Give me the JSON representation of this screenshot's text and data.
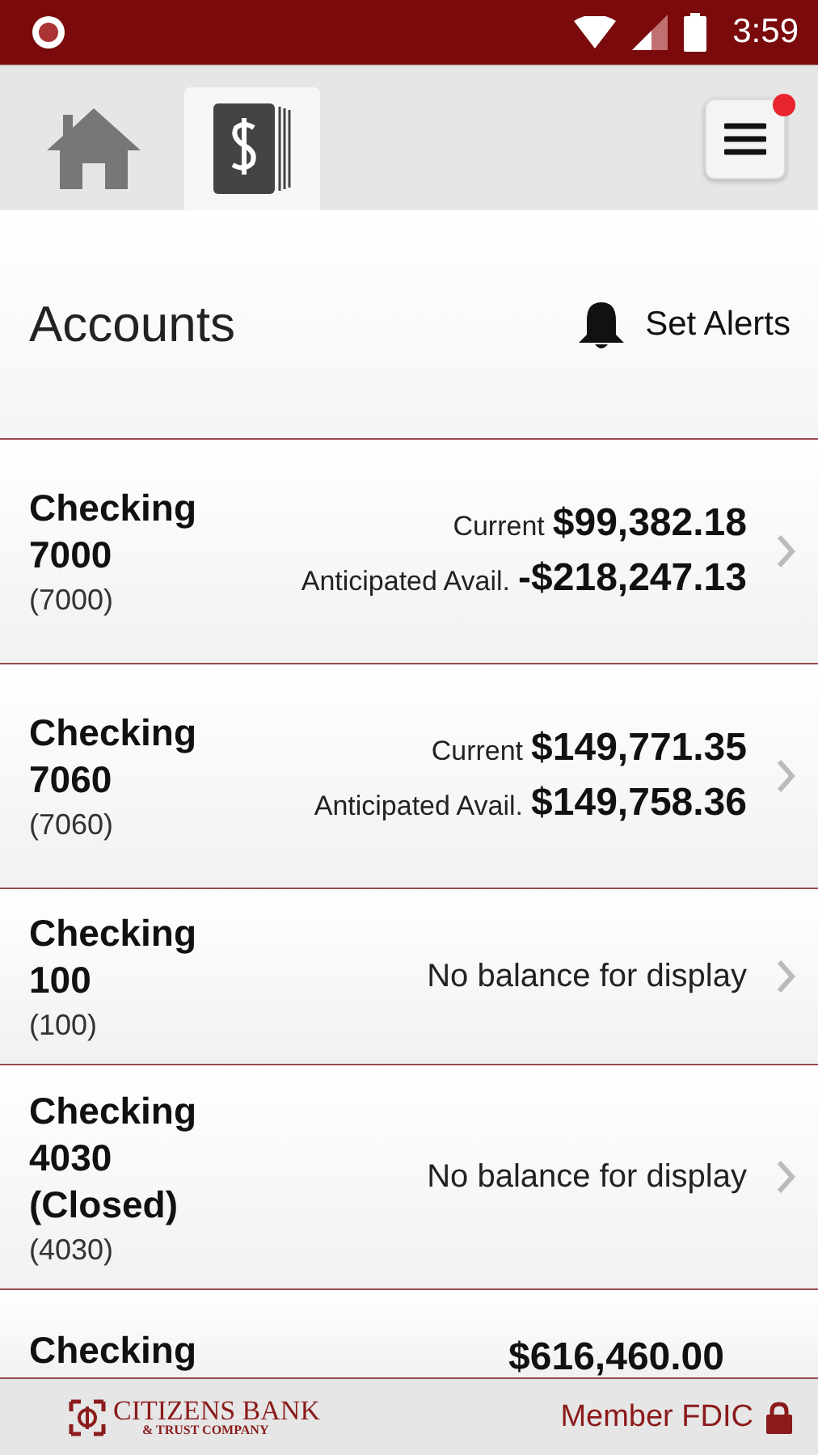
{
  "status_bar": {
    "time": "3:59"
  },
  "tabs": [
    {
      "kind": "home",
      "selected": false
    },
    {
      "kind": "accounts",
      "selected": true
    }
  ],
  "menu": {
    "notification": true
  },
  "header": {
    "title": "Accounts",
    "alerts_label": "Set Alerts"
  },
  "accounts": [
    {
      "kind": "balance",
      "name": "Checking 7000",
      "number": "(7000)",
      "current_label": "Current",
      "current": "$99,382.18",
      "avail_label": "Anticipated Avail.",
      "avail": "-$218,247.13"
    },
    {
      "kind": "balance",
      "name": "Checking 7060",
      "number": "(7060)",
      "current_label": "Current",
      "current": "$149,771.35",
      "avail_label": "Anticipated Avail.",
      "avail": "$149,758.36"
    },
    {
      "kind": "empty",
      "name": "Checking 100",
      "number": "(100)",
      "message": "No balance for display"
    },
    {
      "kind": "empty",
      "name": "Checking 4030 (Closed)",
      "number": "(4030)",
      "message": "No balance for display"
    },
    {
      "kind": "partial",
      "name": "Checking",
      "current": "$616,460.00"
    }
  ],
  "footer": {
    "logo_main": "CITIZENS BANK",
    "logo_sub": "& TRUST COMPANY",
    "fdic": "Member FDIC"
  }
}
